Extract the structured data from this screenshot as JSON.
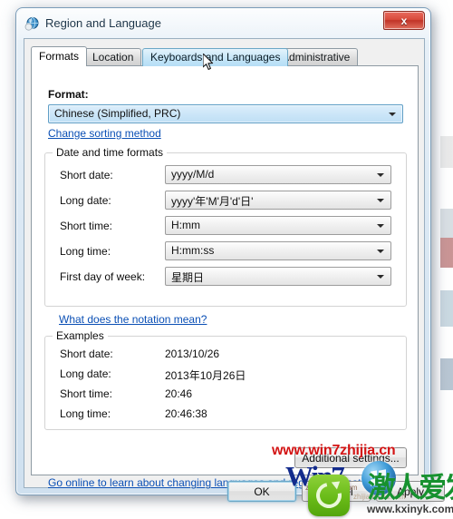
{
  "window": {
    "title": "Region and Language",
    "icon": "globe-icon",
    "close_label": "x",
    "accent": "#0a4fb5",
    "close_color": "#c03427"
  },
  "tabs": [
    {
      "label": "Formats",
      "state": "active"
    },
    {
      "label": "Location",
      "state": "normal"
    },
    {
      "label": "Keyboards and Languages",
      "state": "hover"
    },
    {
      "label": "Administrative",
      "state": "normal"
    }
  ],
  "format": {
    "label": "Format:",
    "value": "Chinese (Simplified, PRC)",
    "sorting_link": "Change sorting method"
  },
  "date_time_group": {
    "title": "Date and time formats",
    "rows": [
      {
        "label": "Short date:",
        "value": "yyyy/M/d"
      },
      {
        "label": "Long date:",
        "value": "yyyy'年'M'月'd'日'"
      },
      {
        "label": "Short time:",
        "value": "H:mm"
      },
      {
        "label": "Long time:",
        "value": "H:mm:ss"
      },
      {
        "label": "First day of week:",
        "value": "星期日"
      }
    ],
    "notation_link": "What does the notation mean?"
  },
  "examples_group": {
    "title": "Examples",
    "rows": [
      {
        "label": "Short date:",
        "value": "2013/10/26"
      },
      {
        "label": "Long date:",
        "value": "2013年10月26日"
      },
      {
        "label": "Short time:",
        "value": "20:46"
      },
      {
        "label": "Long time:",
        "value": "20:46:38"
      }
    ]
  },
  "additional_settings_button": "Additional settings...",
  "online_link": "Go online to learn about changing languages and regional formats",
  "dialog_buttons": {
    "ok": "OK",
    "cancel": "Cancel",
    "apply": "Apply"
  },
  "watermarks": {
    "red_url": "www.win7zhijia.cn",
    "win7_text": "Win7",
    "win7_sub": "zhijia.baidu.com",
    "calligraphy": "激人爱发",
    "bottom_url": "www.kxinyk.com",
    "faint_url": "zhijia.baidu.com"
  }
}
